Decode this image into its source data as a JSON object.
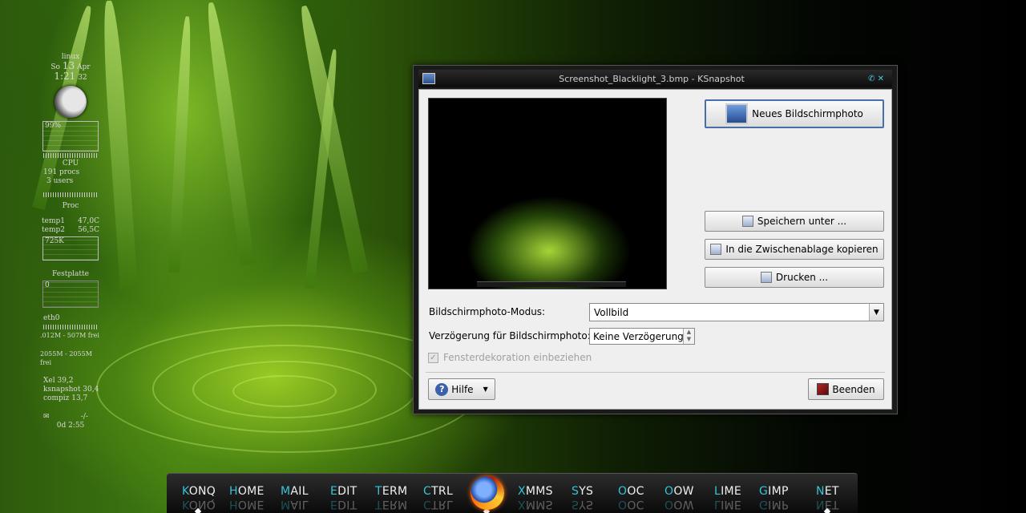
{
  "monitor": {
    "host": "linux",
    "day": "So",
    "date_num": "13",
    "month": "Apr",
    "time": "1:21",
    "seconds": "32",
    "cpu_percent": "99%",
    "cpu_label": "CPU",
    "procs": "191 procs",
    "users": "3 users",
    "proc_label": "Proc",
    "temp1_label": "temp1",
    "temp1_value": "47,0C",
    "temp2_label": "temp2",
    "temp2_value": "56,5C",
    "mem_value": "725K",
    "disk_label": "Festplatte",
    "disk_value": "0",
    "net_label": "eth0",
    "net_line1": ".012M - 507M frei",
    "net_line2": "2055M - 2055M frei",
    "top1": "Xel 39,2",
    "top2": "ksnapshot 30,4",
    "top3": "compiz 13,7",
    "mail_count": "-/-",
    "uptime": "0d  2:55"
  },
  "window": {
    "title": "Screenshot_Blacklight_3.bmp - KSnapshot",
    "btn_new": "Neues Bildschirmphoto",
    "btn_save": "Speichern unter ...",
    "btn_copy": "In die Zwischenablage kopieren",
    "btn_print": "Drucken ...",
    "mode_label": "Bildschirmphoto-Modus:",
    "mode_value": "Vollbild",
    "delay_label": "Verzögerung für Bildschirmphoto:",
    "delay_value": "Keine Verzögerung",
    "deco_label": "Fensterdekoration einbeziehen",
    "btn_help": "Hilfe",
    "btn_quit": "Beenden"
  },
  "dock": [
    {
      "first": "K",
      "rest": "ONQ"
    },
    {
      "first": "H",
      "rest": "OME"
    },
    {
      "first": "M",
      "rest": "AIL"
    },
    {
      "first": "E",
      "rest": "DIT"
    },
    {
      "first": "T",
      "rest": "ERM"
    },
    {
      "first": "C",
      "rest": "TRL"
    },
    {
      "first": "X",
      "rest": "MMS"
    },
    {
      "first": "S",
      "rest": "YS"
    },
    {
      "first": "O",
      "rest": "OC"
    },
    {
      "first": "O",
      "rest": "OW"
    },
    {
      "first": "L",
      "rest": "IME"
    },
    {
      "first": "G",
      "rest": "IMP"
    },
    {
      "first": "N",
      "rest": "ET"
    }
  ]
}
